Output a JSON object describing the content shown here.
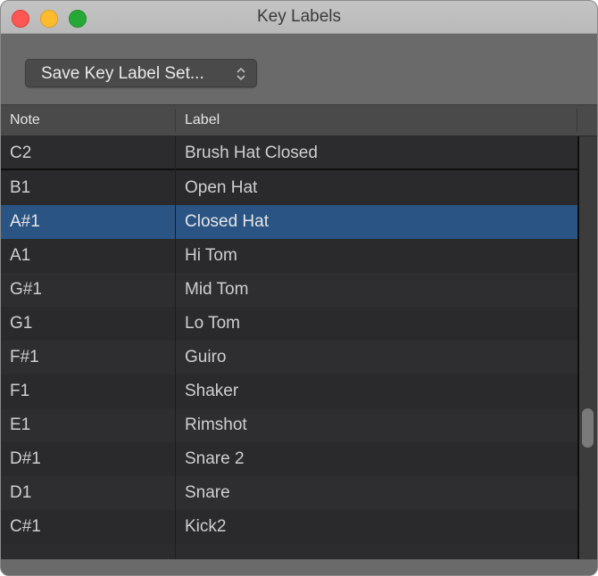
{
  "window": {
    "title": "Key Labels",
    "traffic_lights": [
      "close",
      "minimize",
      "zoom"
    ]
  },
  "toolbar": {
    "popup_label": "Save Key Label Set...",
    "popup_icon": "up-down-chevron-icon"
  },
  "table": {
    "columns": [
      {
        "key": "note",
        "label": "Note"
      },
      {
        "key": "label",
        "label": "Label"
      }
    ],
    "rows": [
      {
        "note": "C2",
        "label": "Brush Hat Closed",
        "state": "editing"
      },
      {
        "note": "B1",
        "label": "Open Hat",
        "state": ""
      },
      {
        "note": "A#1",
        "label": "Closed Hat",
        "state": "selected"
      },
      {
        "note": "A1",
        "label": "Hi Tom",
        "state": ""
      },
      {
        "note": "G#1",
        "label": "Mid Tom",
        "state": ""
      },
      {
        "note": "G1",
        "label": "Lo Tom",
        "state": ""
      },
      {
        "note": "F#1",
        "label": "Guiro",
        "state": ""
      },
      {
        "note": "F1",
        "label": "Shaker",
        "state": ""
      },
      {
        "note": "E1",
        "label": "Rimshot",
        "state": ""
      },
      {
        "note": "D#1",
        "label": "Snare 2",
        "state": ""
      },
      {
        "note": "D1",
        "label": "Snare",
        "state": ""
      },
      {
        "note": "C#1",
        "label": "Kick2",
        "state": ""
      }
    ],
    "selected_note": "A#1",
    "scroll_position": 0.72
  },
  "colors": {
    "selection": "#2a5484",
    "close": "#fc5753",
    "minimize": "#fdbc2e",
    "zoom": "#26a836"
  }
}
